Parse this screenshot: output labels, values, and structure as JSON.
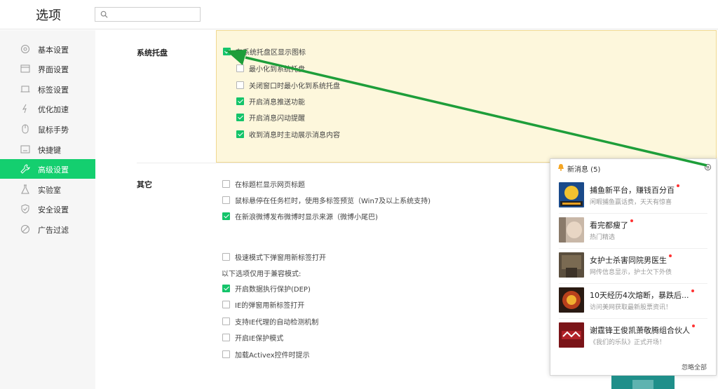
{
  "window": {
    "title": "选项"
  },
  "search": {
    "placeholder": ""
  },
  "sidebar": {
    "items": [
      {
        "label": "基本设置",
        "icon": "gear-icon"
      },
      {
        "label": "界面设置",
        "icon": "window-icon"
      },
      {
        "label": "标签设置",
        "icon": "tab-icon"
      },
      {
        "label": "优化加速",
        "icon": "lightning-icon"
      },
      {
        "label": "鼠标手势",
        "icon": "mouse-icon"
      },
      {
        "label": "快捷键",
        "icon": "keyboard-icon"
      },
      {
        "label": "高级设置",
        "icon": "wrench-icon",
        "active": true
      },
      {
        "label": "实验室",
        "icon": "flask-icon"
      },
      {
        "label": "安全设置",
        "icon": "shield-icon"
      },
      {
        "label": "广告过滤",
        "icon": "block-icon"
      }
    ],
    "active_color": "#14cf6f"
  },
  "tray": {
    "label": "系统托盘",
    "options": [
      {
        "label": "在系统托盘区显示图标",
        "checked": true
      },
      {
        "label": "最小化到系统托盘",
        "checked": false
      },
      {
        "label": "关闭窗口时最小化到系统托盘",
        "checked": false
      },
      {
        "label": "开启消息推送功能",
        "checked": true
      },
      {
        "label": "开启消息闪动提醒",
        "checked": true
      },
      {
        "label": "收到消息时主动展示消息内容",
        "checked": true
      }
    ]
  },
  "other": {
    "label": "其它",
    "options": [
      {
        "label": "在标题栏显示网页标题",
        "checked": false
      },
      {
        "label": "鼠标悬停在任务栏时，使用多标签预览（Win7及以上系统支持)",
        "checked": false
      },
      {
        "label": "在新浪微博发布微博时显示来源（微博小尾巴)",
        "checked": true
      },
      {
        "label": "极速模式下弹窗用新标签打开",
        "checked": false
      }
    ],
    "compat_heading": "以下选项仅用于兼容模式:",
    "compat_options": [
      {
        "label": "开启数据执行保护(DEP)",
        "checked": true
      },
      {
        "label": "IE的弹窗用新标签打开",
        "checked": false
      },
      {
        "label": "支持IE代理的自动检测机制",
        "checked": false
      },
      {
        "label": "开启IE保护模式",
        "checked": false
      },
      {
        "label": "加载Activex控件时提示",
        "checked": false
      }
    ]
  },
  "popup": {
    "title": "新消息 (5)",
    "items": [
      {
        "title": "捕鱼新平台，赚钱百分百",
        "subtitle": "闲暇捕鱼赢话费，天天有惊喜"
      },
      {
        "title": "看完都瘦了",
        "subtitle": "热门精选"
      },
      {
        "title": "女护士杀害同院男医生",
        "subtitle": "网传信息显示，护士欠下外债"
      },
      {
        "title": "10天经历4次熔断，暴跌后...",
        "subtitle": "访问美网获取最新股票资讯！"
      },
      {
        "title": "谢霆锋王俊凯萧敬腾组合伙人",
        "subtitle": "《我们的乐队》正式开场！"
      }
    ],
    "ignore_all": "忽略全部",
    "dot_color": "#ff3333"
  },
  "colors": {
    "check": "#14c46a",
    "arrow": "#1e9e3a",
    "highlight_bg": "#fdf7dc"
  }
}
